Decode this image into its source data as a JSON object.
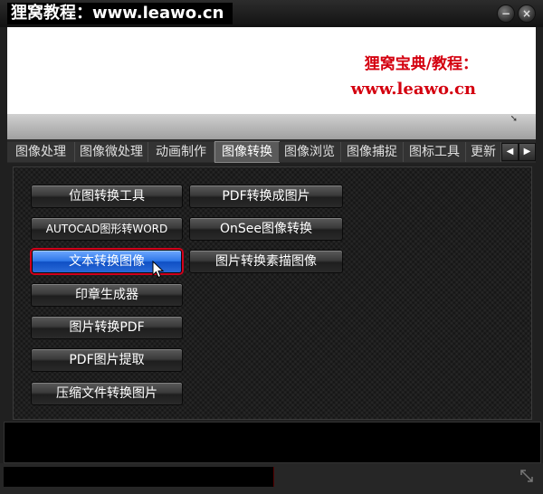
{
  "window": {
    "title": "狸窝教程：www.leawo.cn",
    "minimize_symbol": "−",
    "close_symbol": "×"
  },
  "banner": {
    "line1": "狸窝宝典/教程：",
    "line2": "www.leawo.cn",
    "accent_color": "#d4000f"
  },
  "tabs": [
    {
      "label": "图像处理"
    },
    {
      "label": "图像微处理"
    },
    {
      "label": "动画制作"
    },
    {
      "label": "图像转换",
      "active": true
    },
    {
      "label": "图像浏览"
    },
    {
      "label": "图像捕捉"
    },
    {
      "label": "图标工具"
    },
    {
      "label": "更新"
    }
  ],
  "tab_scroll": {
    "left": "◀",
    "right": "▶"
  },
  "buttons": {
    "bitmap_convert": "位图转换工具",
    "autocad_to_word": "AUTOCAD图形转WORD",
    "text_to_image": "文本转换图像",
    "seal_generator": "印章生成器",
    "image_to_pdf": "图片转换PDF",
    "pdf_image_extract": "PDF图片提取",
    "archive_to_image": "压缩文件转换图片",
    "pdf_to_image": "PDF转换成图片",
    "onsee_convert": "OnSee图像转换",
    "image_to_sketch": "图片转换素描图像"
  },
  "colors": {
    "selected_button": "#2f78e8",
    "selection_outline": "#d1001c"
  }
}
